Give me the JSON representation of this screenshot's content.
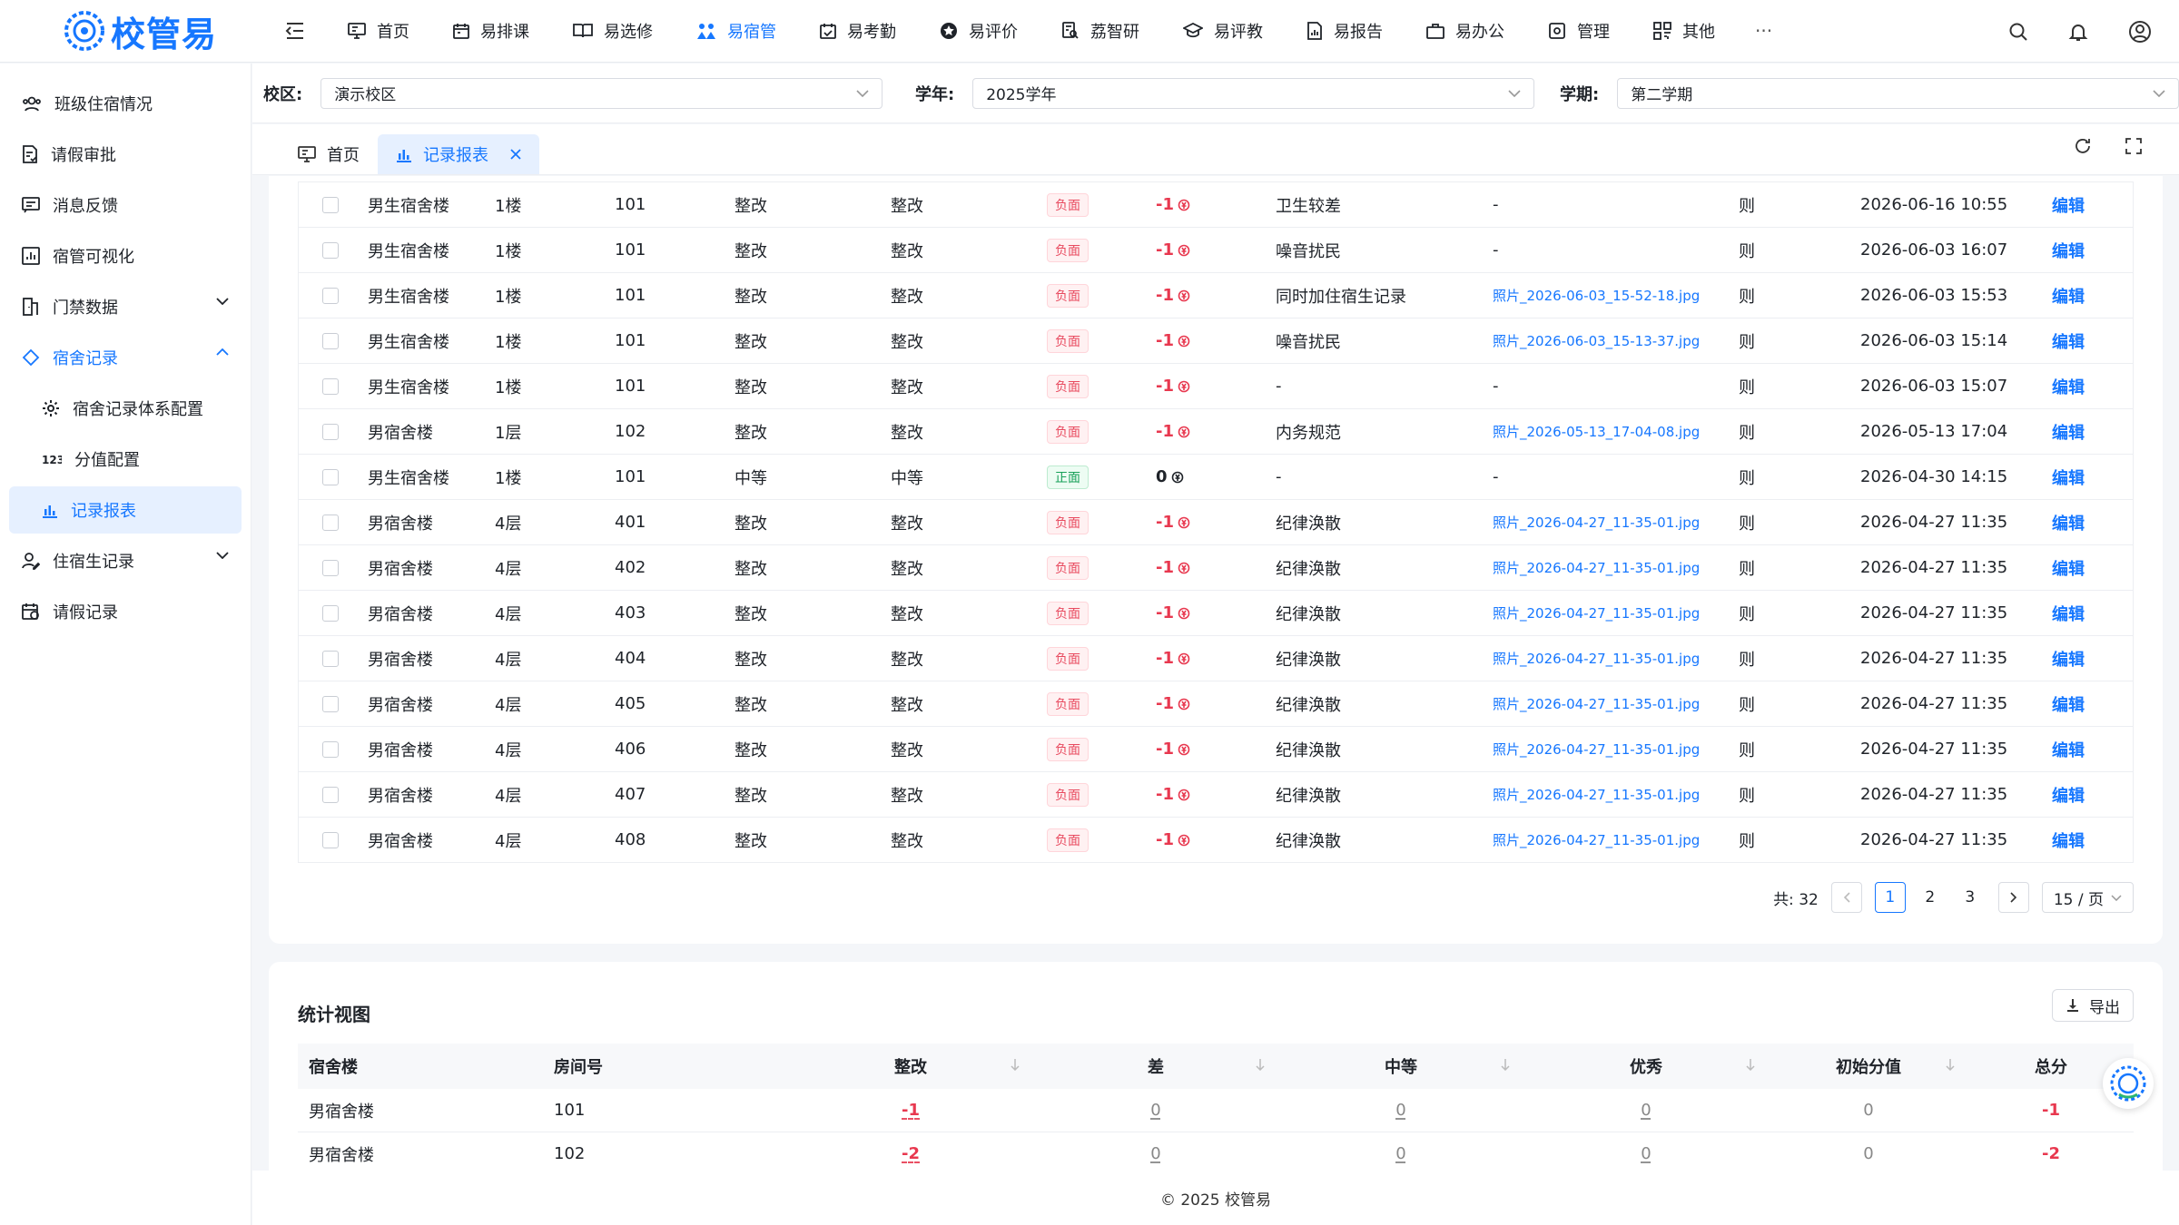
{
  "app": {
    "logo_text": "校管易"
  },
  "topnav": [
    {
      "label": "首页",
      "icon": "monitor-icon"
    },
    {
      "label": "易排课",
      "icon": "calendar-icon"
    },
    {
      "label": "易选修",
      "icon": "book-icon"
    },
    {
      "label": "易宿管",
      "icon": "dorm-icon",
      "active": true
    },
    {
      "label": "易考勤",
      "icon": "calendar-check-icon"
    },
    {
      "label": "易评价",
      "icon": "star-icon"
    },
    {
      "label": "荔智研",
      "icon": "research-icon"
    },
    {
      "label": "易评教",
      "icon": "graduation-cap-icon"
    },
    {
      "label": "易报告",
      "icon": "report-icon"
    },
    {
      "label": "易办公",
      "icon": "briefcase-icon"
    },
    {
      "label": "管理",
      "icon": "settings-icon"
    },
    {
      "label": "其他",
      "icon": "grid-icon"
    }
  ],
  "topnav_more": "···",
  "sidebar": [
    {
      "label": "班级住宿情况",
      "icon": "users-icon"
    },
    {
      "label": "请假审批",
      "icon": "approve-icon"
    },
    {
      "label": "消息反馈",
      "icon": "message-icon"
    },
    {
      "label": "宿管可视化",
      "icon": "chart-box-icon"
    },
    {
      "label": "门禁数据",
      "icon": "door-icon",
      "caret": "down"
    },
    {
      "label": "宿舍记录",
      "icon": "dorm-record-icon",
      "caret": "up",
      "open": true
    },
    {
      "label": "宿舍记录体系配置",
      "icon": "gear-icon",
      "sub": true
    },
    {
      "label": "分值配置",
      "icon": "number-icon",
      "sub": true
    },
    {
      "label": "记录报表",
      "icon": "bar-chart-icon",
      "sub": true,
      "active": true
    },
    {
      "label": "住宿生记录",
      "icon": "user-edit-icon",
      "caret": "down"
    },
    {
      "label": "请假记录",
      "icon": "calendar-leave-icon"
    }
  ],
  "filters": {
    "campus_label": "校区:",
    "campus_value": "演示校区",
    "year_label": "学年:",
    "year_value": "2025学年",
    "term_label": "学期:",
    "term_value": "第二学期"
  },
  "tabs": {
    "home": "首页",
    "report": "记录报表"
  },
  "records": [
    {
      "building": "男生宿舍楼",
      "floor": "1楼",
      "room": "101",
      "c1": "整改",
      "c2": "整改",
      "type": "负面",
      "score": "-1",
      "reason": "卫生较差",
      "photo": "-",
      "unit": "则",
      "time": "2026-06-16 10:55",
      "action": "编辑"
    },
    {
      "building": "男生宿舍楼",
      "floor": "1楼",
      "room": "101",
      "c1": "整改",
      "c2": "整改",
      "type": "负面",
      "score": "-1",
      "reason": "噪音扰民",
      "photo": "-",
      "unit": "则",
      "time": "2026-06-03 16:07",
      "action": "编辑"
    },
    {
      "building": "男生宿舍楼",
      "floor": "1楼",
      "room": "101",
      "c1": "整改",
      "c2": "整改",
      "type": "负面",
      "score": "-1",
      "reason": "同时加住宿生记录",
      "photo": "照片_2026-06-03_15-52-18.jpg",
      "unit": "则",
      "time": "2026-06-03 15:53",
      "action": "编辑"
    },
    {
      "building": "男生宿舍楼",
      "floor": "1楼",
      "room": "101",
      "c1": "整改",
      "c2": "整改",
      "type": "负面",
      "score": "-1",
      "reason": "噪音扰民",
      "photo": "照片_2026-06-03_15-13-37.jpg",
      "unit": "则",
      "time": "2026-06-03 15:14",
      "action": "编辑"
    },
    {
      "building": "男生宿舍楼",
      "floor": "1楼",
      "room": "101",
      "c1": "整改",
      "c2": "整改",
      "type": "负面",
      "score": "-1",
      "reason": "-",
      "photo": "-",
      "unit": "则",
      "time": "2026-06-03 15:07",
      "action": "编辑"
    },
    {
      "building": "男宿舍楼",
      "floor": "1层",
      "room": "102",
      "c1": "整改",
      "c2": "整改",
      "type": "负面",
      "score": "-1",
      "reason": "内务规范",
      "photo": "照片_2026-05-13_17-04-08.jpg",
      "unit": "则",
      "time": "2026-05-13 17:04",
      "action": "编辑"
    },
    {
      "building": "男生宿舍楼",
      "floor": "1楼",
      "room": "101",
      "c1": "中等",
      "c2": "中等",
      "type": "正面",
      "score": "0",
      "reason": "-",
      "photo": "-",
      "unit": "则",
      "time": "2026-04-30 14:15",
      "action": "编辑"
    },
    {
      "building": "男宿舍楼",
      "floor": "4层",
      "room": "401",
      "c1": "整改",
      "c2": "整改",
      "type": "负面",
      "score": "-1",
      "reason": "纪律涣散",
      "photo": "照片_2026-04-27_11-35-01.jpg",
      "unit": "则",
      "time": "2026-04-27 11:35",
      "action": "编辑"
    },
    {
      "building": "男宿舍楼",
      "floor": "4层",
      "room": "402",
      "c1": "整改",
      "c2": "整改",
      "type": "负面",
      "score": "-1",
      "reason": "纪律涣散",
      "photo": "照片_2026-04-27_11-35-01.jpg",
      "unit": "则",
      "time": "2026-04-27 11:35",
      "action": "编辑"
    },
    {
      "building": "男宿舍楼",
      "floor": "4层",
      "room": "403",
      "c1": "整改",
      "c2": "整改",
      "type": "负面",
      "score": "-1",
      "reason": "纪律涣散",
      "photo": "照片_2026-04-27_11-35-01.jpg",
      "unit": "则",
      "time": "2026-04-27 11:35",
      "action": "编辑"
    },
    {
      "building": "男宿舍楼",
      "floor": "4层",
      "room": "404",
      "c1": "整改",
      "c2": "整改",
      "type": "负面",
      "score": "-1",
      "reason": "纪律涣散",
      "photo": "照片_2026-04-27_11-35-01.jpg",
      "unit": "则",
      "time": "2026-04-27 11:35",
      "action": "编辑"
    },
    {
      "building": "男宿舍楼",
      "floor": "4层",
      "room": "405",
      "c1": "整改",
      "c2": "整改",
      "type": "负面",
      "score": "-1",
      "reason": "纪律涣散",
      "photo": "照片_2026-04-27_11-35-01.jpg",
      "unit": "则",
      "time": "2026-04-27 11:35",
      "action": "编辑"
    },
    {
      "building": "男宿舍楼",
      "floor": "4层",
      "room": "406",
      "c1": "整改",
      "c2": "整改",
      "type": "负面",
      "score": "-1",
      "reason": "纪律涣散",
      "photo": "照片_2026-04-27_11-35-01.jpg",
      "unit": "则",
      "time": "2026-04-27 11:35",
      "action": "编辑"
    },
    {
      "building": "男宿舍楼",
      "floor": "4层",
      "room": "407",
      "c1": "整改",
      "c2": "整改",
      "type": "负面",
      "score": "-1",
      "reason": "纪律涣散",
      "photo": "照片_2026-04-27_11-35-01.jpg",
      "unit": "则",
      "time": "2026-04-27 11:35",
      "action": "编辑"
    },
    {
      "building": "男宿舍楼",
      "floor": "4层",
      "room": "408",
      "c1": "整改",
      "c2": "整改",
      "type": "负面",
      "score": "-1",
      "reason": "纪律涣散",
      "photo": "照片_2026-04-27_11-35-01.jpg",
      "unit": "则",
      "time": "2026-04-27 11:35",
      "action": "编辑"
    }
  ],
  "pagination": {
    "total": "共: 32",
    "pages": [
      "1",
      "2",
      "3"
    ],
    "current": "1",
    "page_size": "15 / 页"
  },
  "stats": {
    "title": "统计视图",
    "export_label": "导出",
    "headers": [
      "宿舍楼",
      "房间号",
      "整改",
      "差",
      "中等",
      "优秀",
      "初始分值",
      "总分"
    ],
    "rows": [
      {
        "building": "男宿舍楼",
        "room": "101",
        "rectify": "-1",
        "poor": "0",
        "medium": "0",
        "excellent": "0",
        "initial": "0",
        "total": "-1"
      },
      {
        "building": "男宿舍楼",
        "room": "102",
        "rectify": "-2",
        "poor": "0",
        "medium": "0",
        "excellent": "0",
        "initial": "0",
        "total": "-2"
      }
    ]
  },
  "footer": "© 2025 校管易",
  "colors": {
    "primary": "#1677ff",
    "negative": "#e8384f",
    "positive": "#18a058"
  }
}
